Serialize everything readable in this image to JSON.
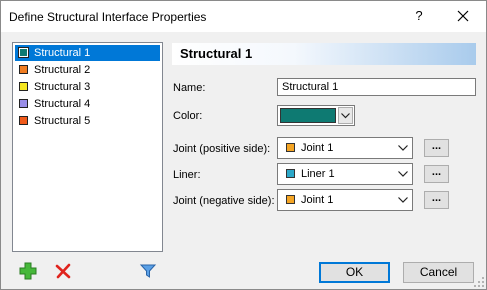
{
  "window": {
    "title": "Define Structural Interface Properties",
    "help_label": "?"
  },
  "structures": [
    {
      "label": "Structural 1",
      "color": "#0e7a72",
      "selected": true
    },
    {
      "label": "Structural 2",
      "color": "#f07d22",
      "selected": false
    },
    {
      "label": "Structural 3",
      "color": "#f5e620",
      "selected": false
    },
    {
      "label": "Structural 4",
      "color": "#9a8fe8",
      "selected": false
    },
    {
      "label": "Structural 5",
      "color": "#f05a1a",
      "selected": false
    }
  ],
  "toolbar": {
    "add_icon": "add-icon",
    "delete_icon": "delete-icon",
    "filter_icon": "filter-icon"
  },
  "header": {
    "title": "Structural 1"
  },
  "form": {
    "name_label": "Name:",
    "name_value": "Structural 1",
    "color_label": "Color:",
    "color_value": "#0e7a72",
    "joint_pos_label": "Joint (positive side):",
    "joint_pos_value": "Joint 1",
    "joint_pos_color": "#f5a524",
    "liner_label": "Liner:",
    "liner_value": "Liner 1",
    "liner_color": "#2ca8c9",
    "joint_neg_label": "Joint (negative side):",
    "joint_neg_value": "Joint 1",
    "joint_neg_color": "#f5a524",
    "browse_label": "..."
  },
  "buttons": {
    "ok": "OK",
    "cancel": "Cancel"
  }
}
